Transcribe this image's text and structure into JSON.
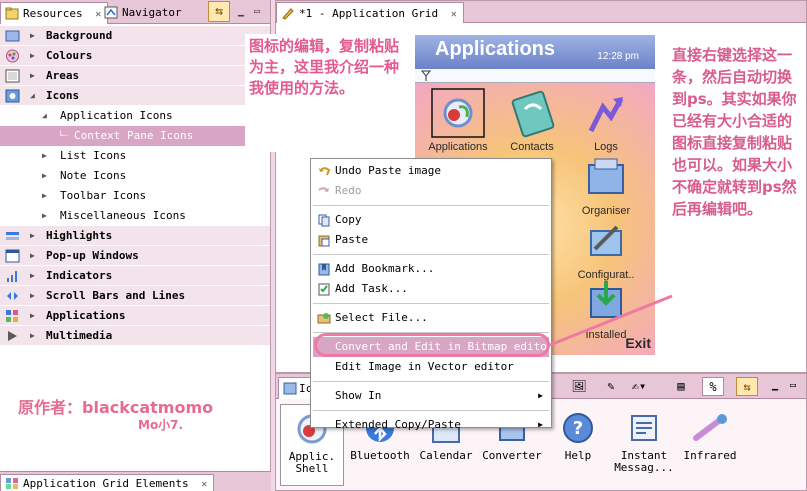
{
  "left_view": {
    "tabs": [
      {
        "label": "Resources",
        "icon": "resources-icon",
        "active": true
      },
      {
        "label": "Navigator",
        "icon": "navigator-icon",
        "active": false
      }
    ],
    "tree": [
      {
        "label": "Background",
        "level": 0,
        "expanded": false,
        "icon": "background-icon"
      },
      {
        "label": "Colours",
        "level": 0,
        "expanded": false,
        "icon": "colours-icon"
      },
      {
        "label": "Areas",
        "level": 0,
        "expanded": false,
        "icon": "areas-icon"
      },
      {
        "label": "Icons",
        "level": 0,
        "expanded": true,
        "icon": "icons-icon"
      },
      {
        "label": "Application Icons",
        "level": 1,
        "expanded": true
      },
      {
        "label": "Context Pane Icons",
        "level": 2,
        "selected": true
      },
      {
        "label": "List Icons",
        "level": 1,
        "expanded": false
      },
      {
        "label": "Note Icons",
        "level": 1,
        "expanded": false
      },
      {
        "label": "Toolbar Icons",
        "level": 1,
        "expanded": false
      },
      {
        "label": "Miscellaneous Icons",
        "level": 1,
        "expanded": false
      },
      {
        "label": "Highlights",
        "level": 0,
        "expanded": false,
        "icon": "highlights-icon"
      },
      {
        "label": "Pop-up Windows",
        "level": 0,
        "expanded": false,
        "icon": "popup-windows-icon"
      },
      {
        "label": "Indicators",
        "level": 0,
        "expanded": false,
        "icon": "indicators-icon"
      },
      {
        "label": "Scroll Bars and Lines",
        "level": 0,
        "expanded": false,
        "icon": "scroll-bars-icon"
      },
      {
        "label": "Applications",
        "level": 0,
        "expanded": false,
        "icon": "applications-icon"
      },
      {
        "label": "Multimedia",
        "level": 0,
        "expanded": false,
        "icon": "multimedia-icon"
      }
    ]
  },
  "bottom_tab": {
    "label": "Application Grid Elements"
  },
  "editor": {
    "tab_label": "*1 - Application Grid",
    "phone": {
      "title": "Applications",
      "time": "12:28 pm",
      "apps": [
        {
          "label": "Applications",
          "icon": "applications-app-icon"
        },
        {
          "label": "Contacts",
          "icon": "contacts-app-icon"
        },
        {
          "label": "Logs",
          "icon": "logs-app-icon"
        },
        {
          "label": "Organiser",
          "icon": "organiser-app-icon"
        },
        {
          "label": "Configurat..",
          "icon": "configuration-app-icon"
        },
        {
          "label": "Installed",
          "icon": "installed-app-icon"
        }
      ],
      "exit_label": "Exit"
    }
  },
  "context_menu": {
    "items": [
      {
        "label": "Undo Paste image",
        "icon": "undo-icon",
        "enabled": true
      },
      {
        "label": "Redo",
        "icon": "redo-icon",
        "enabled": false
      },
      {
        "separator": true
      },
      {
        "label": "Copy",
        "icon": "copy-icon",
        "enabled": true
      },
      {
        "label": "Paste",
        "icon": "paste-icon",
        "enabled": true
      },
      {
        "separator": true
      },
      {
        "label": "Add Bookmark...",
        "icon": "bookmark-icon",
        "enabled": true
      },
      {
        "label": "Add Task...",
        "icon": "task-icon",
        "enabled": true
      },
      {
        "separator": true
      },
      {
        "label": "Select File...",
        "icon": "select-file-icon",
        "enabled": true
      },
      {
        "separator": true
      },
      {
        "label": "Convert and Edit in Bitmap editor",
        "enabled": true,
        "highlighted": true
      },
      {
        "label": "Edit Image in Vector editor",
        "enabled": true
      },
      {
        "separator": true
      },
      {
        "label": "Show In",
        "enabled": true,
        "submenu": true
      },
      {
        "separator": true
      },
      {
        "label": "Extended Copy/Paste",
        "enabled": true,
        "submenu": true
      }
    ]
  },
  "palette": {
    "tab_label": "Ic",
    "items": [
      {
        "label": "Applic.\nShell",
        "icon": "application-shell-icon",
        "selected": true
      },
      {
        "label": "Bluetooth",
        "icon": "bluetooth-icon"
      },
      {
        "label": "Calendar",
        "icon": "calendar-icon"
      },
      {
        "label": "Converter",
        "icon": "converter-icon"
      },
      {
        "label": "Help",
        "icon": "help-icon"
      },
      {
        "label": "Instant\nMessag...",
        "icon": "instant-messaging-icon"
      },
      {
        "label": "Infrared",
        "icon": "infrared-icon"
      }
    ]
  },
  "annotations": {
    "left_note": "图标的编辑，复制粘贴为主，这里我介绍一种我使用的方法。",
    "right_note": "直接右键选择这一条，然后自动切换到ps。其实如果你已经有大小合适的图标直接复制粘贴也可以。如果大小不确定就转到ps然后再编辑吧。",
    "author": "原作者：blackcatmomo",
    "signature": "Mo小7."
  },
  "colors": {
    "selection": "#d8a5c5",
    "annotation_pink": "#e35a8f",
    "chrome_pink": "#e7c6d7"
  }
}
